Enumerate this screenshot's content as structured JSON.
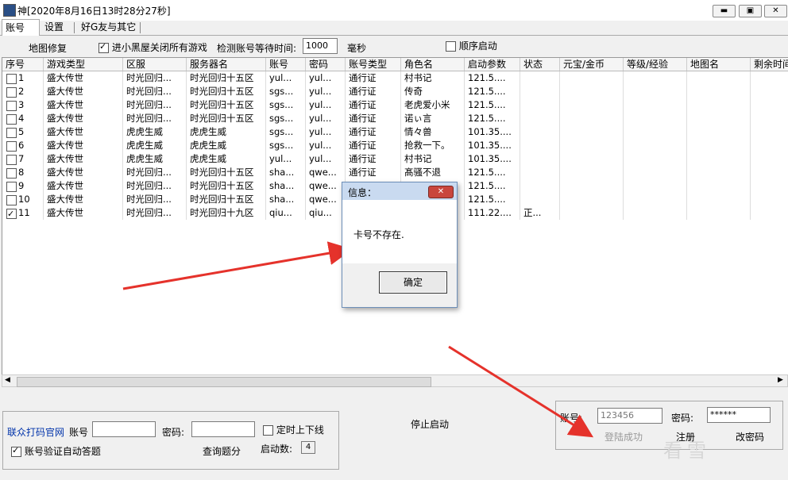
{
  "window": {
    "title": "神[2020年8月16日13时28分27秒]",
    "buttons": [
      "▬",
      "▣",
      "✕"
    ]
  },
  "tabs": [
    "账号",
    "设置",
    "好G友与其它"
  ],
  "options": {
    "map_repair": "地图修复",
    "close_all_games": {
      "label": "进小黑屋关闭所有游戏",
      "checked": true
    },
    "wait_label": "检测账号等待时间:",
    "wait_value": "1000",
    "wait_unit": "毫秒",
    "sequential": {
      "label": "顺序启动",
      "checked": false
    }
  },
  "grid": {
    "columns": [
      "序号",
      "游戏类型",
      "区服",
      "服务器名",
      "账号",
      "密码",
      "账号类型",
      "角色名",
      "启动参数",
      "状态",
      "元宝/金币",
      "等级/经验",
      "地图名",
      "剩余时间"
    ],
    "rows": [
      {
        "no": "1",
        "checked": false,
        "game": "盛大传世",
        "zone": "时光回归...",
        "server": "时光回归十五区",
        "acct": "yul...",
        "pwd": "yul...",
        "type": "通行证",
        "role": "村书记",
        "param": "121.5....",
        "status": ""
      },
      {
        "no": "2",
        "checked": false,
        "game": "盛大传世",
        "zone": "时光回归...",
        "server": "时光回归十五区",
        "acct": "sgs...",
        "pwd": "yul...",
        "type": "通行证",
        "role": "传奇",
        "param": "121.5....",
        "status": ""
      },
      {
        "no": "3",
        "checked": false,
        "game": "盛大传世",
        "zone": "时光回归...",
        "server": "时光回归十五区",
        "acct": "sgs...",
        "pwd": "yul...",
        "type": "通行证",
        "role": "老虎爱小米",
        "param": "121.5....",
        "status": ""
      },
      {
        "no": "4",
        "checked": false,
        "game": "盛大传世",
        "zone": "时光回归...",
        "server": "时光回归十五区",
        "acct": "sgs...",
        "pwd": "yul...",
        "type": "通行证",
        "role": "诺ぃ言",
        "param": "121.5....",
        "status": ""
      },
      {
        "no": "5",
        "checked": false,
        "game": "盛大传世",
        "zone": "虎虎生威",
        "server": "虎虎生威",
        "acct": "sgs...",
        "pwd": "yul...",
        "type": "通行证",
        "role": "情々兽",
        "param": "101.35....",
        "status": ""
      },
      {
        "no": "6",
        "checked": false,
        "game": "盛大传世",
        "zone": "虎虎生威",
        "server": "虎虎生威",
        "acct": "sgs...",
        "pwd": "yul...",
        "type": "通行证",
        "role": "抢救一下。",
        "param": "101.35....",
        "status": ""
      },
      {
        "no": "7",
        "checked": false,
        "game": "盛大传世",
        "zone": "虎虎生威",
        "server": "虎虎生威",
        "acct": "yul...",
        "pwd": "yul...",
        "type": "通行证",
        "role": "村书记",
        "param": "101.35....",
        "status": ""
      },
      {
        "no": "8",
        "checked": false,
        "game": "盛大传世",
        "zone": "时光回归...",
        "server": "时光回归十五区",
        "acct": "sha...",
        "pwd": "qwe...",
        "type": "通行证",
        "role": "髙骚不退",
        "param": "121.5....",
        "status": ""
      },
      {
        "no": "9",
        "checked": false,
        "game": "盛大传世",
        "zone": "时光回归...",
        "server": "时光回归十五区",
        "acct": "sha...",
        "pwd": "qwe...",
        "type": "",
        "role": "",
        "param": "121.5....",
        "status": ""
      },
      {
        "no": "10",
        "checked": false,
        "game": "盛大传世",
        "zone": "时光回归...",
        "server": "时光回归十五区",
        "acct": "sha...",
        "pwd": "qwe...",
        "type": "",
        "role": "",
        "param": "121.5....",
        "status": ""
      },
      {
        "no": "11",
        "checked": true,
        "game": "盛大传世",
        "zone": "时光回归...",
        "server": "时光回归十九区",
        "acct": "qiu...",
        "pwd": "qiu...",
        "type": "",
        "role": "",
        "param": "111.22....",
        "status": "正..."
      }
    ]
  },
  "bottom_left": {
    "site_link": "联众打码官网",
    "acct_label": "账号",
    "acct_value": "",
    "pwd_label": "密码:",
    "pwd_value": "",
    "timed_online": {
      "label": "定时上下线",
      "checked": false
    },
    "auto_answer": {
      "label": "账号验证自动答题",
      "checked": true
    },
    "query_points": "查询题分",
    "launch_count_label": "启动数:",
    "launch_count": "4"
  },
  "stop_launch": "停止启动",
  "bottom_right": {
    "acct_label": "账号:",
    "acct_value": "123456",
    "pwd_label": "密码:",
    "pwd_value": "******",
    "login_status": "登陆成功",
    "register": "注册",
    "change_pwd": "改密码"
  },
  "dialog": {
    "title": "信息：",
    "message": "卡号不存在.",
    "ok": "确定",
    "close": "✕"
  },
  "watermark": "看雪"
}
